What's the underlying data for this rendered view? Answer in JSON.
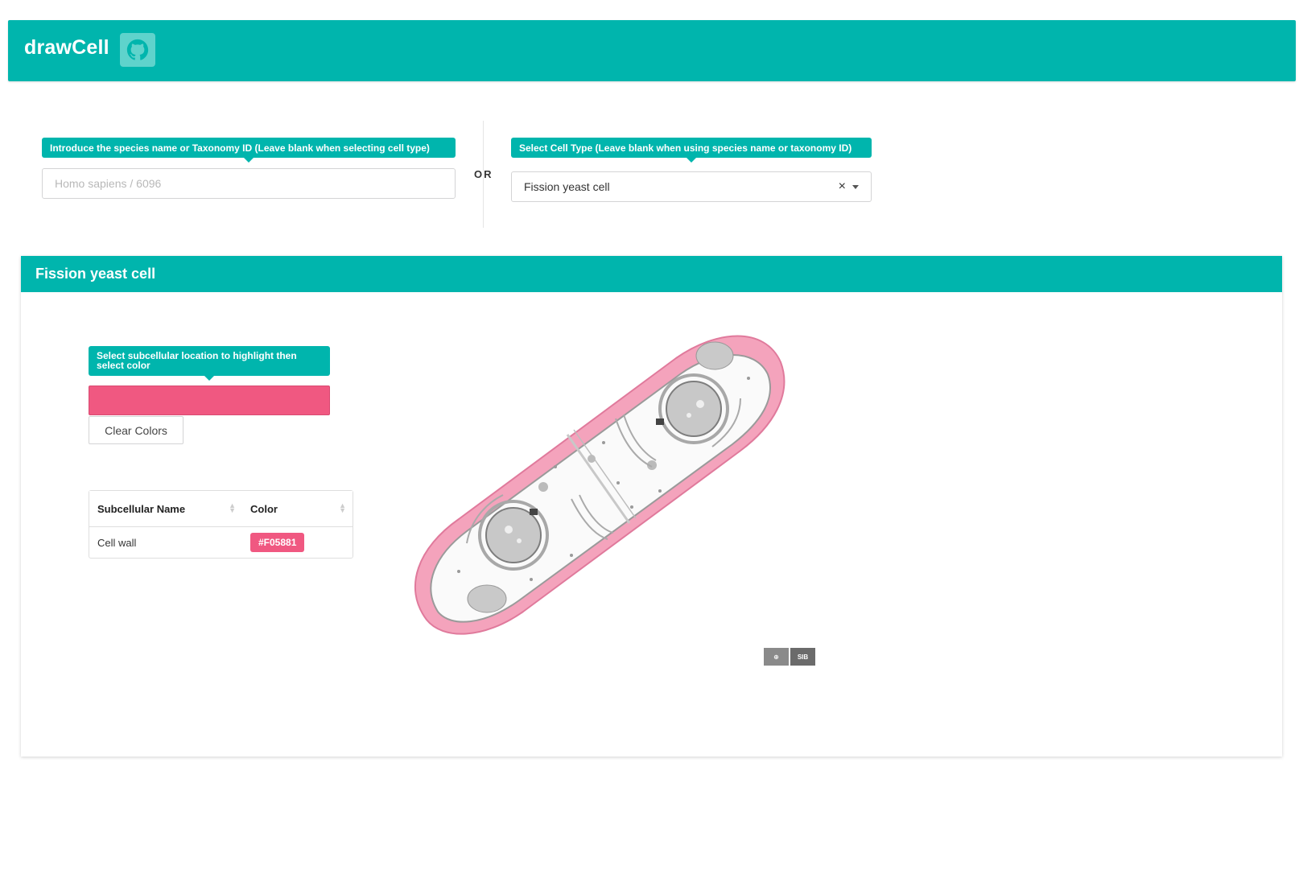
{
  "app": {
    "title": "drawCell"
  },
  "species": {
    "label": "Introduce the species name or Taxonomy ID (Leave blank when selecting cell type)",
    "placeholder": "Homo sapiens / 6096",
    "value": ""
  },
  "separator": "OR",
  "cell_type": {
    "label": "Select Cell Type (Leave blank when using species name or taxonomy ID)",
    "selected": "Fission yeast cell",
    "clear_glyph": "×"
  },
  "panel": {
    "title": "Fission yeast cell",
    "subcell_label": "Select subcellular location to highlight then select color",
    "current_color": "#f05881",
    "clear_button": "Clear Colors",
    "table": {
      "headers": [
        "Subcellular Name",
        "Color"
      ],
      "rows": [
        {
          "name": "Cell wall",
          "color": "#F05881"
        }
      ]
    }
  },
  "icons": [
    "github-icon",
    "close-icon",
    "caret-down-icon",
    "sort-icon",
    "sib-logo-icon"
  ],
  "colors": {
    "brand": "#00b5ad",
    "highlight": "#f05881"
  }
}
